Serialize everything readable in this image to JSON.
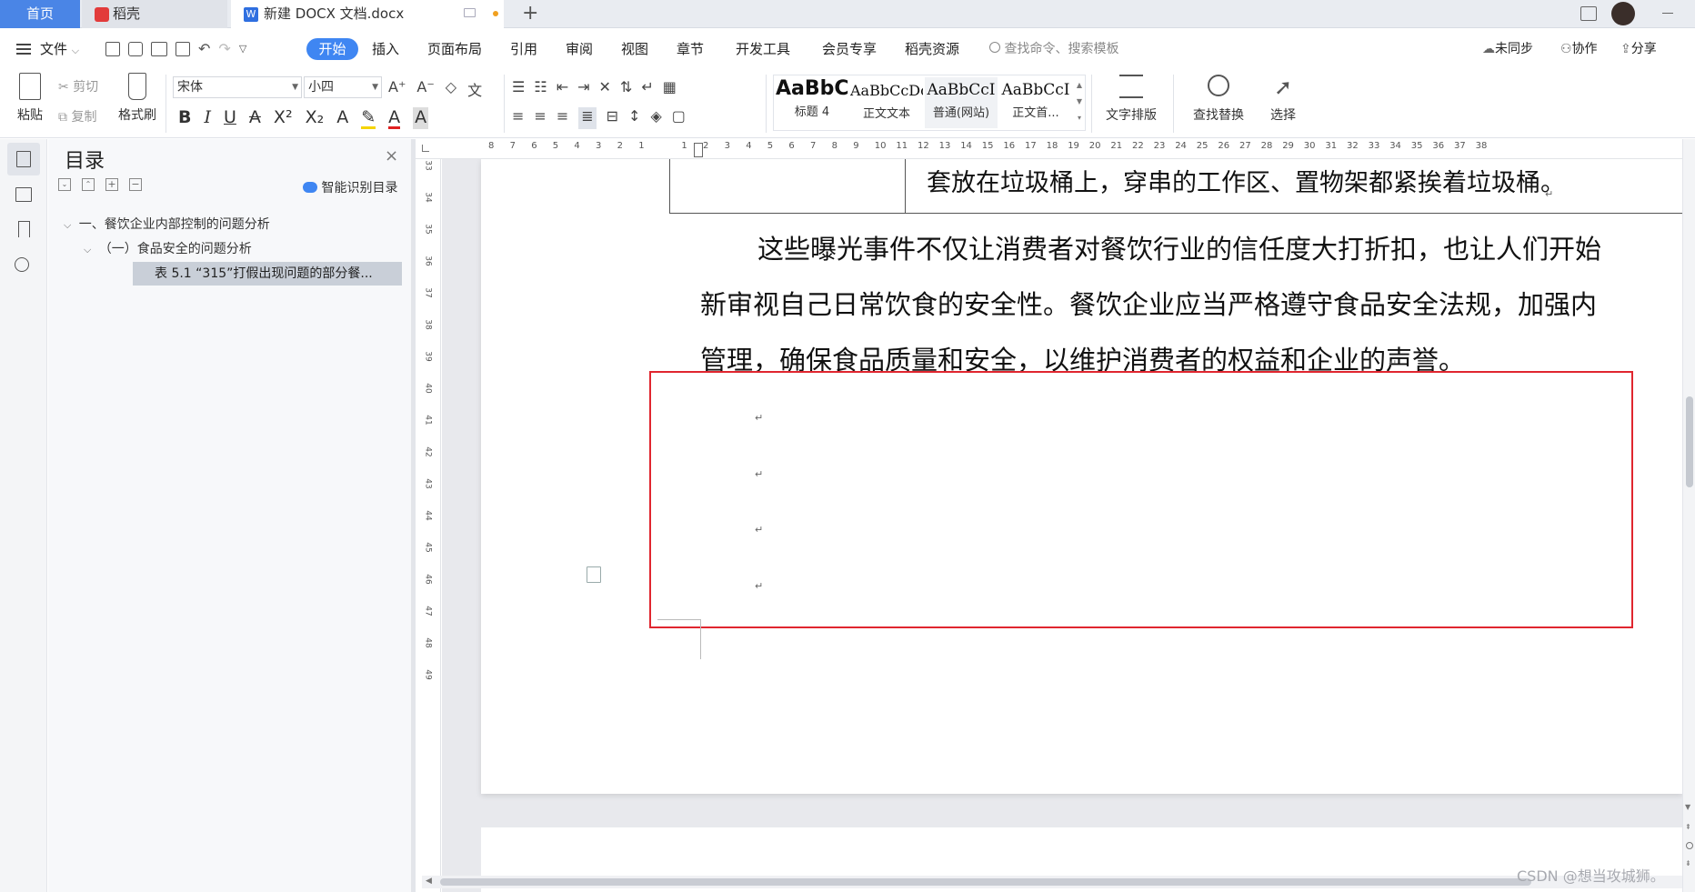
{
  "tabs": {
    "home": "首页",
    "daoke": "稻壳",
    "document": "新建 DOCX 文档.docx"
  },
  "menu": {
    "file": "文件",
    "items": [
      "开始",
      "插入",
      "页面布局",
      "引用",
      "审阅",
      "视图",
      "章节",
      "开发工具",
      "会员专享",
      "稻壳资源"
    ],
    "search_placeholder": "查找命令、搜索模板",
    "sync": "未同步",
    "collab": "协作",
    "share": "分享"
  },
  "ribbon": {
    "paste": "粘贴",
    "cut": "剪切",
    "copy": "复制",
    "format_painter": "格式刷",
    "font_name": "宋体",
    "font_size": "小四",
    "styles": [
      {
        "preview": "AaBbC",
        "name": "标题 4"
      },
      {
        "preview": "AaBbCcDc",
        "name": "正文文本"
      },
      {
        "preview": "AaBbCcI",
        "name": "普通(网站)"
      },
      {
        "preview": "AaBbCcI",
        "name": "正文首..."
      }
    ],
    "text_layout": "文字排版",
    "find_replace": "查找替换",
    "select": "选择"
  },
  "toc": {
    "title": "目录",
    "smart_button": "智能识别目录",
    "items": [
      {
        "level": 1,
        "text": "一、餐饮企业内部控制的问题分析"
      },
      {
        "level": 2,
        "text": "（一）食品安全的问题分析"
      },
      {
        "level": 3,
        "text": "表 5.1 “315”打假出现问题的部分餐..."
      }
    ]
  },
  "ruler": {
    "h_ticks": [
      "8",
      "7",
      "6",
      "5",
      "4",
      "3",
      "2",
      "1",
      "",
      "1",
      "2",
      "3",
      "4",
      "5",
      "6",
      "7",
      "8",
      "9",
      "10",
      "11",
      "12",
      "13",
      "14",
      "15",
      "16",
      "17",
      "18",
      "19",
      "20",
      "21",
      "22",
      "23",
      "24",
      "25",
      "26",
      "27",
      "28",
      "29",
      "30",
      "31",
      "32",
      "33",
      "34",
      "35",
      "36",
      "37",
      "38"
    ],
    "v_ticks": [
      "33",
      "34",
      "35",
      "36",
      "37",
      "38",
      "39",
      "40",
      "41",
      "42",
      "43",
      "44",
      "45",
      "46",
      "47",
      "48",
      "49"
    ]
  },
  "document": {
    "table_cell_text": "套放在垃圾桶上，穿串的工作区、置物架都紧挨着垃圾桶。",
    "paragraph_lines": [
      "这些曝光事件不仅让消费者对餐饮行业的信任度大打折扣，也让人们开始",
      "新审视自己日常饮食的安全性。餐饮企业应当严格遵守食品安全法规，加强内",
      "管理，确保食品质量和安全，以维护消费者的权益和企业的声誉。"
    ],
    "paragraph_mark": "↵"
  },
  "watermark": "CSDN @想当攻城狮。",
  "colors": {
    "accent": "#3f86f2",
    "tab_home": "#4a85e6",
    "highlight_box": "#e0262f",
    "toc_selected": "#c9cfd8"
  }
}
